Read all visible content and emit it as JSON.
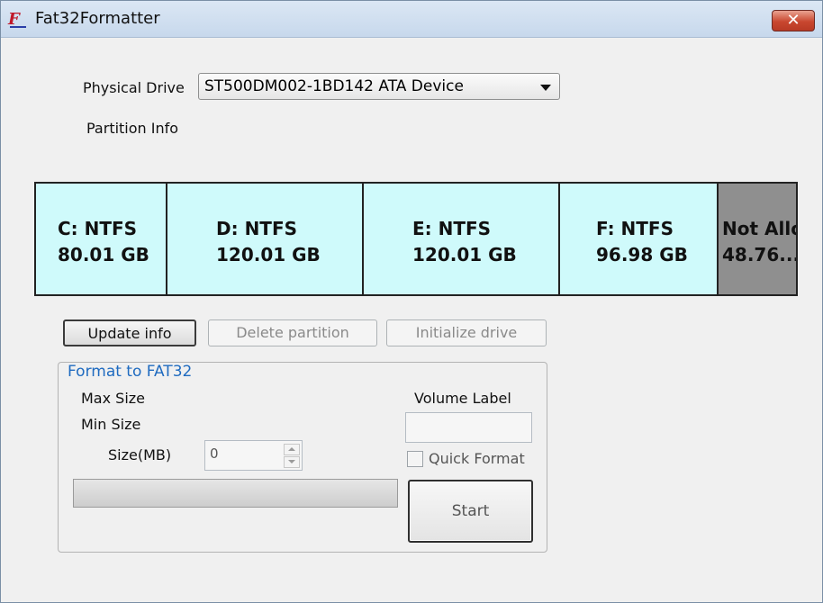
{
  "window": {
    "title": "Fat32Formatter",
    "close_glyph": "✕"
  },
  "drive": {
    "label": "Physical Drive",
    "selected": "ST500DM002-1BD142 ATA Device",
    "partition_info_label": "Partition Info"
  },
  "partitions": [
    {
      "fs": "C: NTFS",
      "size": "80.01 GB",
      "allocated": true
    },
    {
      "fs": "D: NTFS",
      "size": "120.01 GB",
      "allocated": true
    },
    {
      "fs": "E: NTFS",
      "size": "120.01 GB",
      "allocated": true
    },
    {
      "fs": "F: NTFS",
      "size": "96.98 GB",
      "allocated": true
    },
    {
      "fs": "Not Allo",
      "size": "48.76...",
      "allocated": false
    }
  ],
  "actions": {
    "update": "Update info",
    "delete": "Delete partition",
    "initialize": "Initialize drive"
  },
  "format": {
    "group_title": "Format to FAT32",
    "max_size_label": "Max Size",
    "min_size_label": "Min Size",
    "size_label": "Size(MB)",
    "size_value": "0",
    "volume_label": "Volume Label",
    "volume_value": "",
    "quick_format_label": "Quick Format",
    "quick_format_checked": false,
    "progress": 0,
    "start": "Start"
  },
  "colors": {
    "partition_fill": "#cffafb",
    "unallocated_fill": "#8f8f8f",
    "group_title": "#1f6bc0",
    "close_button": "#c9472f"
  }
}
